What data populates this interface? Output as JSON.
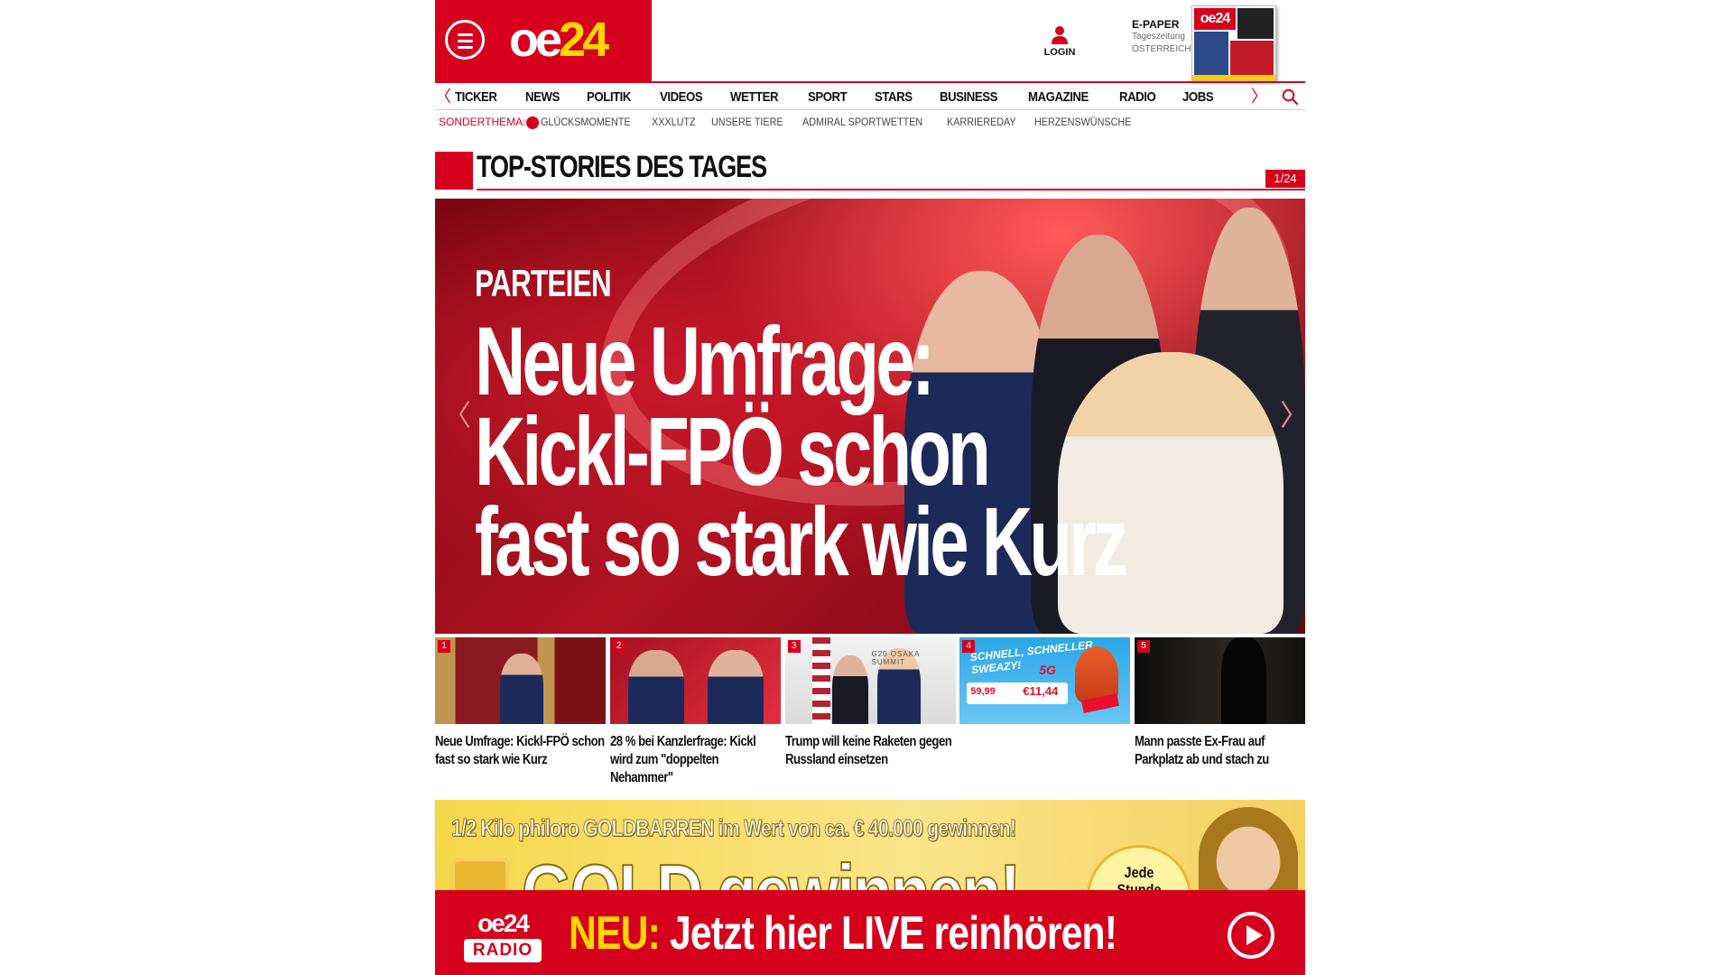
{
  "header": {
    "logo": {
      "text_a": "oe",
      "text_b": "24"
    },
    "menu_icon": "hamburger-menu-icon",
    "login_label": "LOGIN",
    "epaper": {
      "title": "E-PAPER",
      "line1": "Tageszeitung",
      "line2": "ÖSTERREICH"
    }
  },
  "nav": {
    "items": [
      "TICKER",
      "NEWS",
      "POLITIK",
      "VIDEOS",
      "WETTER",
      "SPORT",
      "STARS",
      "BUSINESS",
      "MAGAZINE",
      "RADIO",
      "JOBS"
    ],
    "prev_arrow": "〈",
    "next_arrow": "〉"
  },
  "subnav": {
    "label": "SONDERTHEMA:",
    "items": [
      "GLÜCKSMOMENTE",
      "XXXLUTZ",
      "UNSERE TIERE",
      "ADMIRAL SPORTWETTEN",
      "KARRIEREDAY",
      "HERZENSWÜNSCHE"
    ]
  },
  "section": {
    "title": "TOP-STORIES DES TAGES",
    "counter": "1/24"
  },
  "hero": {
    "kicker": "PARTEIEN",
    "title_lines": [
      "Neue Umfrage:",
      "Kickl-FPÖ schon",
      "fast so stark wie Kurz"
    ],
    "prev_arrow": "〈",
    "next_arrow": "〉"
  },
  "teasers": [
    {
      "num": "1",
      "caption": "Neue Umfrage: Kickl-FPÖ schon fast so stark wie Kurz"
    },
    {
      "num": "2",
      "caption": "28 % bei Kanzlerfrage: Kickl wird zum \"doppelten Nehammer\""
    },
    {
      "num": "3",
      "caption": "Trump will keine Raketen gegen Russland einsetzen",
      "image_text": "G20 OSAKA SUMMIT"
    },
    {
      "num": "4",
      "caption": "",
      "image_slogan": "SCHNELL, SCHNELLER, SWEAZY!",
      "image_5g": "5G",
      "price_a": "59,99",
      "price_b": "€11,44"
    },
    {
      "num": "5",
      "caption": "Mann passte Ex-Frau auf Parkplatz ab und stach zu"
    }
  ],
  "ad": {
    "headline": "1/2 Kilo philoro GOLDBARREN im Wert von ca. € 40.000 gewinnen!",
    "big": "GOLD gewinnen!",
    "circle_line1": "Jede",
    "circle_line2": "Stunde"
  },
  "radio_bar": {
    "logo_top": "oe24",
    "logo_bottom": "RADIO",
    "neu": "NEU:",
    "text": " Jetzt hier LIVE reinhören!"
  },
  "colors": {
    "brand_red": "#d6001c",
    "brand_yellow": "#ffd700"
  }
}
